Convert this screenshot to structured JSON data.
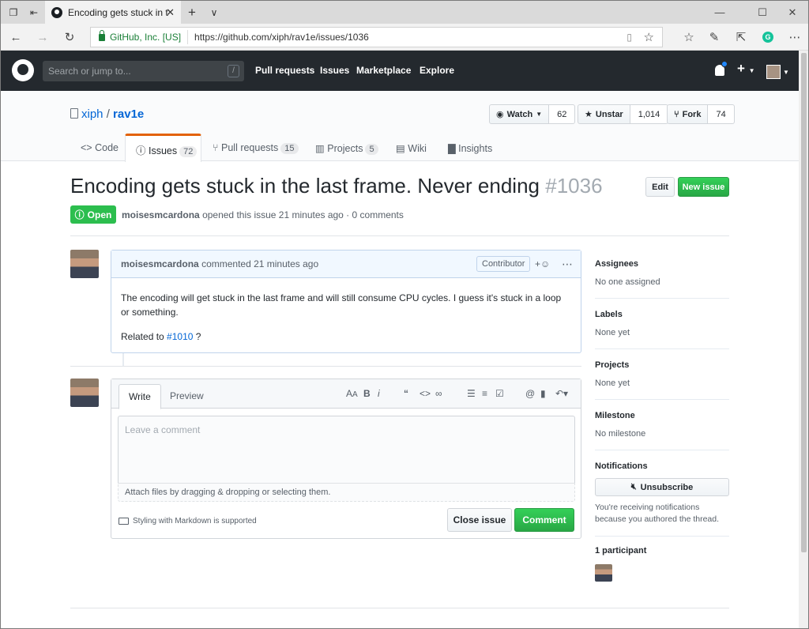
{
  "browser": {
    "tab_title": "Encoding gets stuck in t",
    "url_security": "GitHub, Inc. [US]",
    "url": "https://github.com/xiph/rav1e/issues/1036"
  },
  "gh_header": {
    "search_placeholder": "Search or jump to...",
    "search_key": "/",
    "nav": [
      "Pull requests",
      "Issues",
      "Marketplace",
      "Explore"
    ]
  },
  "repo": {
    "owner": "xiph",
    "name": "rav1e",
    "watch_label": "Watch",
    "watch_count": "62",
    "star_label": "Unstar",
    "star_count": "1,014",
    "fork_label": "Fork",
    "fork_count": "74",
    "tabs": [
      {
        "label": "Code",
        "count": ""
      },
      {
        "label": "Issues",
        "count": "72"
      },
      {
        "label": "Pull requests",
        "count": "15"
      },
      {
        "label": "Projects",
        "count": "5"
      },
      {
        "label": "Wiki",
        "count": ""
      },
      {
        "label": "Insights",
        "count": ""
      }
    ]
  },
  "issue": {
    "title": "Encoding gets stuck in the last frame. Never ending",
    "number": "#1036",
    "edit_label": "Edit",
    "new_issue_label": "New issue",
    "state": "Open",
    "author": "moisesmcardona",
    "meta_text": "opened this issue 21 minutes ago · 0 comments"
  },
  "comment": {
    "author": "moisesmcardona",
    "time": "commented 21 minutes ago",
    "badge": "Contributor",
    "body_line1": "The encoding will get stuck in the last frame and will still consume CPU cycles. I guess it's stuck in a loop or something.",
    "related_prefix": "Related to ",
    "related_link": "#1010",
    "related_suffix": " ?"
  },
  "form": {
    "tab_write": "Write",
    "tab_preview": "Preview",
    "placeholder": "Leave a comment",
    "attach_text": "Attach files by dragging & dropping or selecting them.",
    "markdown_note": "Styling with Markdown is supported",
    "close_label": "Close issue",
    "comment_label": "Comment"
  },
  "sidebar": {
    "assignees_label": "Assignees",
    "assignees_value": "No one assigned",
    "labels_label": "Labels",
    "labels_value": "None yet",
    "projects_label": "Projects",
    "projects_value": "None yet",
    "milestone_label": "Milestone",
    "milestone_value": "No milestone",
    "notifications_label": "Notifications",
    "unsubscribe_label": "Unsubscribe",
    "notif_reason": "You're receiving notifications because you authored the thread.",
    "participants_label": "1 participant"
  }
}
